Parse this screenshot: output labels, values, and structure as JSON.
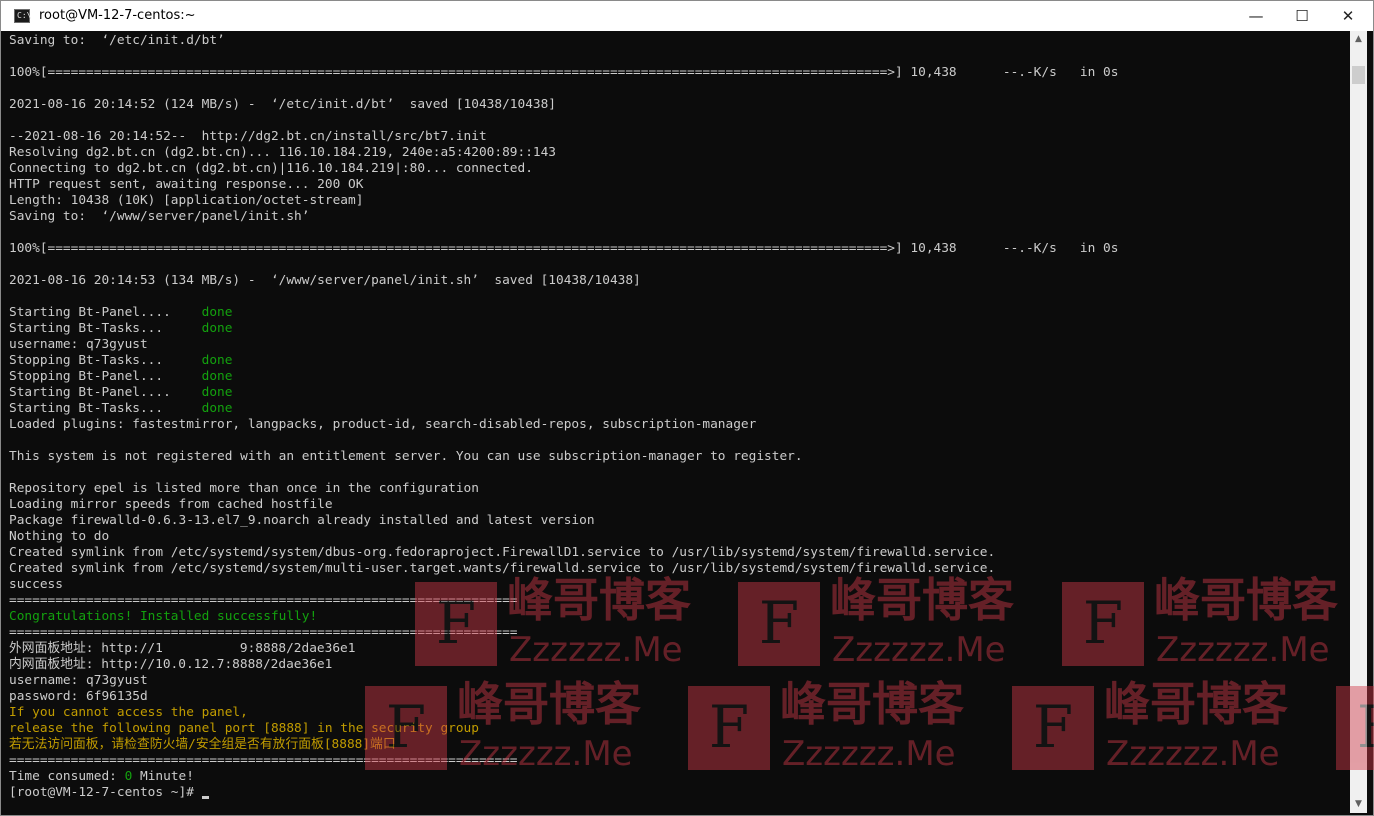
{
  "window": {
    "title": "root@VM-12-7-centos:~",
    "icon_name": "console-app-icon",
    "icon_text": "C:\\",
    "minimize": "—",
    "maximize": "☐",
    "close": "✕"
  },
  "console": {
    "lines": [
      [
        {
          "t": "Saving to:  ‘/etc/init.d/bt’"
        }
      ],
      [
        {
          "t": ""
        }
      ],
      [
        {
          "t": "100%[=============================================================================================================>] 10,438      --.-K/s   in 0s"
        }
      ],
      [
        {
          "t": ""
        }
      ],
      [
        {
          "t": "2021-08-16 20:14:52 (124 MB/s) -  ‘/etc/init.d/bt’  saved [10438/10438]"
        }
      ],
      [
        {
          "t": ""
        }
      ],
      [
        {
          "t": "--2021-08-16 20:14:52--  http://dg2.bt.cn/install/src/bt7.init"
        }
      ],
      [
        {
          "t": "Resolving dg2.bt.cn (dg2.bt.cn)... 116.10.184.219, 240e:a5:4200:89::143"
        }
      ],
      [
        {
          "t": "Connecting to dg2.bt.cn (dg2.bt.cn)|116.10.184.219|:80... connected."
        }
      ],
      [
        {
          "t": "HTTP request sent, awaiting response... 200 OK"
        }
      ],
      [
        {
          "t": "Length: 10438 (10K) [application/octet-stream]"
        }
      ],
      [
        {
          "t": "Saving to:  ‘/www/server/panel/init.sh’"
        }
      ],
      [
        {
          "t": ""
        }
      ],
      [
        {
          "t": "100%[=============================================================================================================>] 10,438      --.-K/s   in 0s"
        }
      ],
      [
        {
          "t": ""
        }
      ],
      [
        {
          "t": "2021-08-16 20:14:53 (134 MB/s) -  ‘/www/server/panel/init.sh’  saved [10438/10438]"
        }
      ],
      [
        {
          "t": ""
        }
      ],
      [
        {
          "t": "Starting Bt-Panel....    "
        },
        {
          "t": "done",
          "c": "ok"
        }
      ],
      [
        {
          "t": "Starting Bt-Tasks...     "
        },
        {
          "t": "done",
          "c": "ok"
        }
      ],
      [
        {
          "t": "username: q73gyust"
        }
      ],
      [
        {
          "t": "Stopping Bt-Tasks...     "
        },
        {
          "t": "done",
          "c": "ok"
        }
      ],
      [
        {
          "t": "Stopping Bt-Panel...     "
        },
        {
          "t": "done",
          "c": "ok"
        }
      ],
      [
        {
          "t": "Starting Bt-Panel....    "
        },
        {
          "t": "done",
          "c": "ok"
        }
      ],
      [
        {
          "t": "Starting Bt-Tasks...     "
        },
        {
          "t": "done",
          "c": "ok"
        }
      ],
      [
        {
          "t": "Loaded plugins: fastestmirror, langpacks, product-id, search-disabled-repos, subscription-manager"
        }
      ],
      [
        {
          "t": ""
        }
      ],
      [
        {
          "t": "This system is not registered with an entitlement server. You can use subscription-manager to register."
        }
      ],
      [
        {
          "t": ""
        }
      ],
      [
        {
          "t": "Repository epel is listed more than once in the configuration"
        }
      ],
      [
        {
          "t": "Loading mirror speeds from cached hostfile"
        }
      ],
      [
        {
          "t": "Package firewalld-0.6.3-13.el7_9.noarch already installed and latest version"
        }
      ],
      [
        {
          "t": "Nothing to do"
        }
      ],
      [
        {
          "t": "Created symlink from /etc/systemd/system/dbus-org.fedoraproject.FirewallD1.service to /usr/lib/systemd/system/firewalld.service."
        }
      ],
      [
        {
          "t": "Created symlink from /etc/systemd/system/multi-user.target.wants/firewalld.service to /usr/lib/systemd/system/firewalld.service."
        }
      ],
      [
        {
          "t": "success"
        }
      ],
      [
        {
          "t": "=================================================================="
        }
      ],
      [
        {
          "t": "Congratulations! Installed successfully!",
          "c": "ok"
        }
      ],
      [
        {
          "t": "=================================================================="
        }
      ],
      [
        {
          "t": "外网面板地址: http://1"
        },
        {
          "t": "          ",
          "c": "hidden"
        },
        {
          "t": "9:8888/2dae36e1"
        }
      ],
      [
        {
          "t": "内网面板地址: http://10.0.12.7:8888/2dae36e1"
        }
      ],
      [
        {
          "t": "username: q73gyust"
        }
      ],
      [
        {
          "t": "password: 6f96135d"
        }
      ],
      [
        {
          "t": "If you cannot access the panel,",
          "c": "warn"
        }
      ],
      [
        {
          "t": "release the following panel port [8888] in the security group",
          "c": "warn"
        }
      ],
      [
        {
          "t": "若无法访问面板，请检查防火墙/安全组是否有放行面板[8888]端口",
          "c": "warn"
        }
      ],
      [
        {
          "t": "=================================================================="
        }
      ],
      [
        {
          "t": "Time consumed: "
        },
        {
          "t": "0",
          "c": "ok"
        },
        {
          "t": " Minute!"
        }
      ],
      [
        {
          "t": "[root@VM-12-7-centos ~]# "
        },
        {
          "t": "",
          "c": "cursor"
        }
      ]
    ]
  },
  "scrollbar": {
    "up_arrow": "▲",
    "down_arrow": "▼"
  },
  "watermark": {
    "logo_letter": "F",
    "chinese_text": "峰哥博客",
    "domain_text": "Zzzzzz.Me",
    "color": "#d23a49"
  }
}
